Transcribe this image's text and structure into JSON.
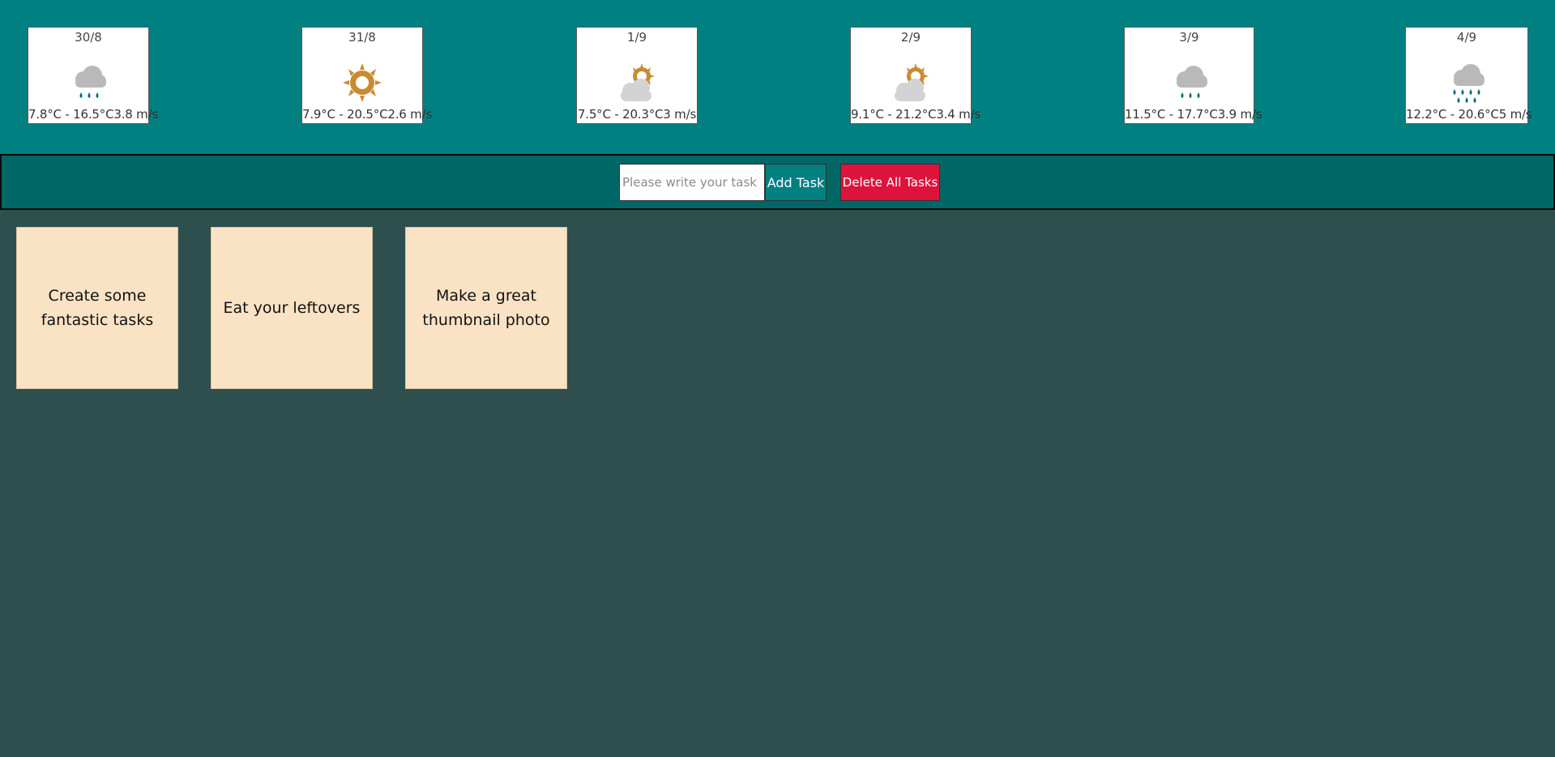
{
  "forecast": [
    {
      "date": "30/8",
      "icon": "rain-cloud-icon",
      "reading": "7.8°C - 16.5°C3.8 m/s"
    },
    {
      "date": "31/8",
      "icon": "sun-icon",
      "reading": "7.9°C - 20.5°C2.6 m/s"
    },
    {
      "date": "1/9",
      "icon": "partly-cloudy-icon",
      "reading": "7.5°C - 20.3°C3 m/s"
    },
    {
      "date": "2/9",
      "icon": "partly-cloudy-icon",
      "reading": "9.1°C - 21.2°C3.4 m/s"
    },
    {
      "date": "3/9",
      "icon": "rain-cloud-icon",
      "reading": "11.5°C - 17.7°C3.9 m/s"
    },
    {
      "date": "4/9",
      "icon": "heavy-rain-cloud-icon",
      "reading": "12.2°C - 20.6°C5 m/s"
    }
  ],
  "task_form": {
    "input_value": "",
    "input_placeholder": "Please write your task",
    "add_label": "Add Task",
    "delete_all_label": "Delete All Tasks"
  },
  "tasks": [
    {
      "text": "Create some fantastic tasks"
    },
    {
      "text": "Eat your leftovers"
    },
    {
      "text": "Make a great thumbnail photo"
    }
  ],
  "colors": {
    "page_bg": "#2f4f4f",
    "weather_bar": "#008080",
    "task_bar": "#006666",
    "add_button": "#008080",
    "delete_button": "#dc143c",
    "note_bg": "#fae3c5",
    "sun": "#c98b32",
    "cloud": "#b9b9b9",
    "rain": "#00687a"
  }
}
